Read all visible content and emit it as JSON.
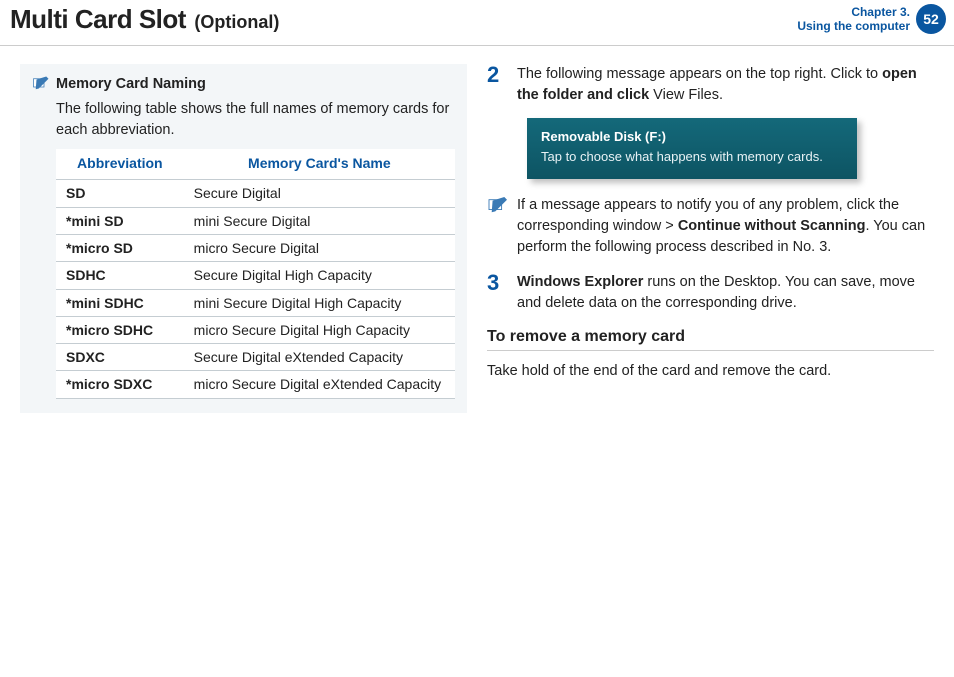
{
  "header": {
    "title_main": "Multi Card Slot",
    "title_sub": "(Optional)",
    "chapter_line1": "Chapter 3.",
    "chapter_line2": "Using the computer",
    "page": "52"
  },
  "left": {
    "note_title": "Memory Card Naming",
    "note_body": "The following table shows the full names of memory cards for each abbreviation.",
    "table": {
      "col1": "Abbreviation",
      "col2": "Memory Card's Name",
      "rows": [
        {
          "a": " SD",
          "b": "Secure Digital"
        },
        {
          "a": "*mini SD",
          "b": "mini Secure Digital"
        },
        {
          "a": "*micro SD",
          "b": "micro Secure Digital"
        },
        {
          "a": " SDHC",
          "b": "Secure Digital High Capacity"
        },
        {
          "a": "*mini SDHC",
          "b": "mini Secure Digital High Capacity"
        },
        {
          "a": "*micro SDHC",
          "b": "micro Secure Digital High Capacity"
        },
        {
          "a": " SDXC",
          "b": "Secure Digital eXtended Capacity"
        },
        {
          "a": "*micro SDXC",
          "b": "micro Secure Digital eXtended Capacity"
        }
      ]
    }
  },
  "right": {
    "step2_num": "2",
    "step2_a": "The following message appears on the top right. Click to ",
    "step2_b": "open the folder and click",
    "step2_c": " View Files.",
    "toast_title": "Removable Disk (F:)",
    "toast_body": "Tap to choose what happens with memory cards.",
    "info_a": "If a message appears to notify you of any problem, click the corresponding window > ",
    "info_b": "Continue without Scanning",
    "info_c": ". You can perform the following process described in No. 3.",
    "step3_num": "3",
    "step3_a": "Windows Explorer",
    "step3_b": " runs on the Desktop. You can save, move and delete data on the corresponding drive.",
    "h2": "To remove a memory card",
    "remove_body": "Take hold of the end of the card and remove the card."
  }
}
